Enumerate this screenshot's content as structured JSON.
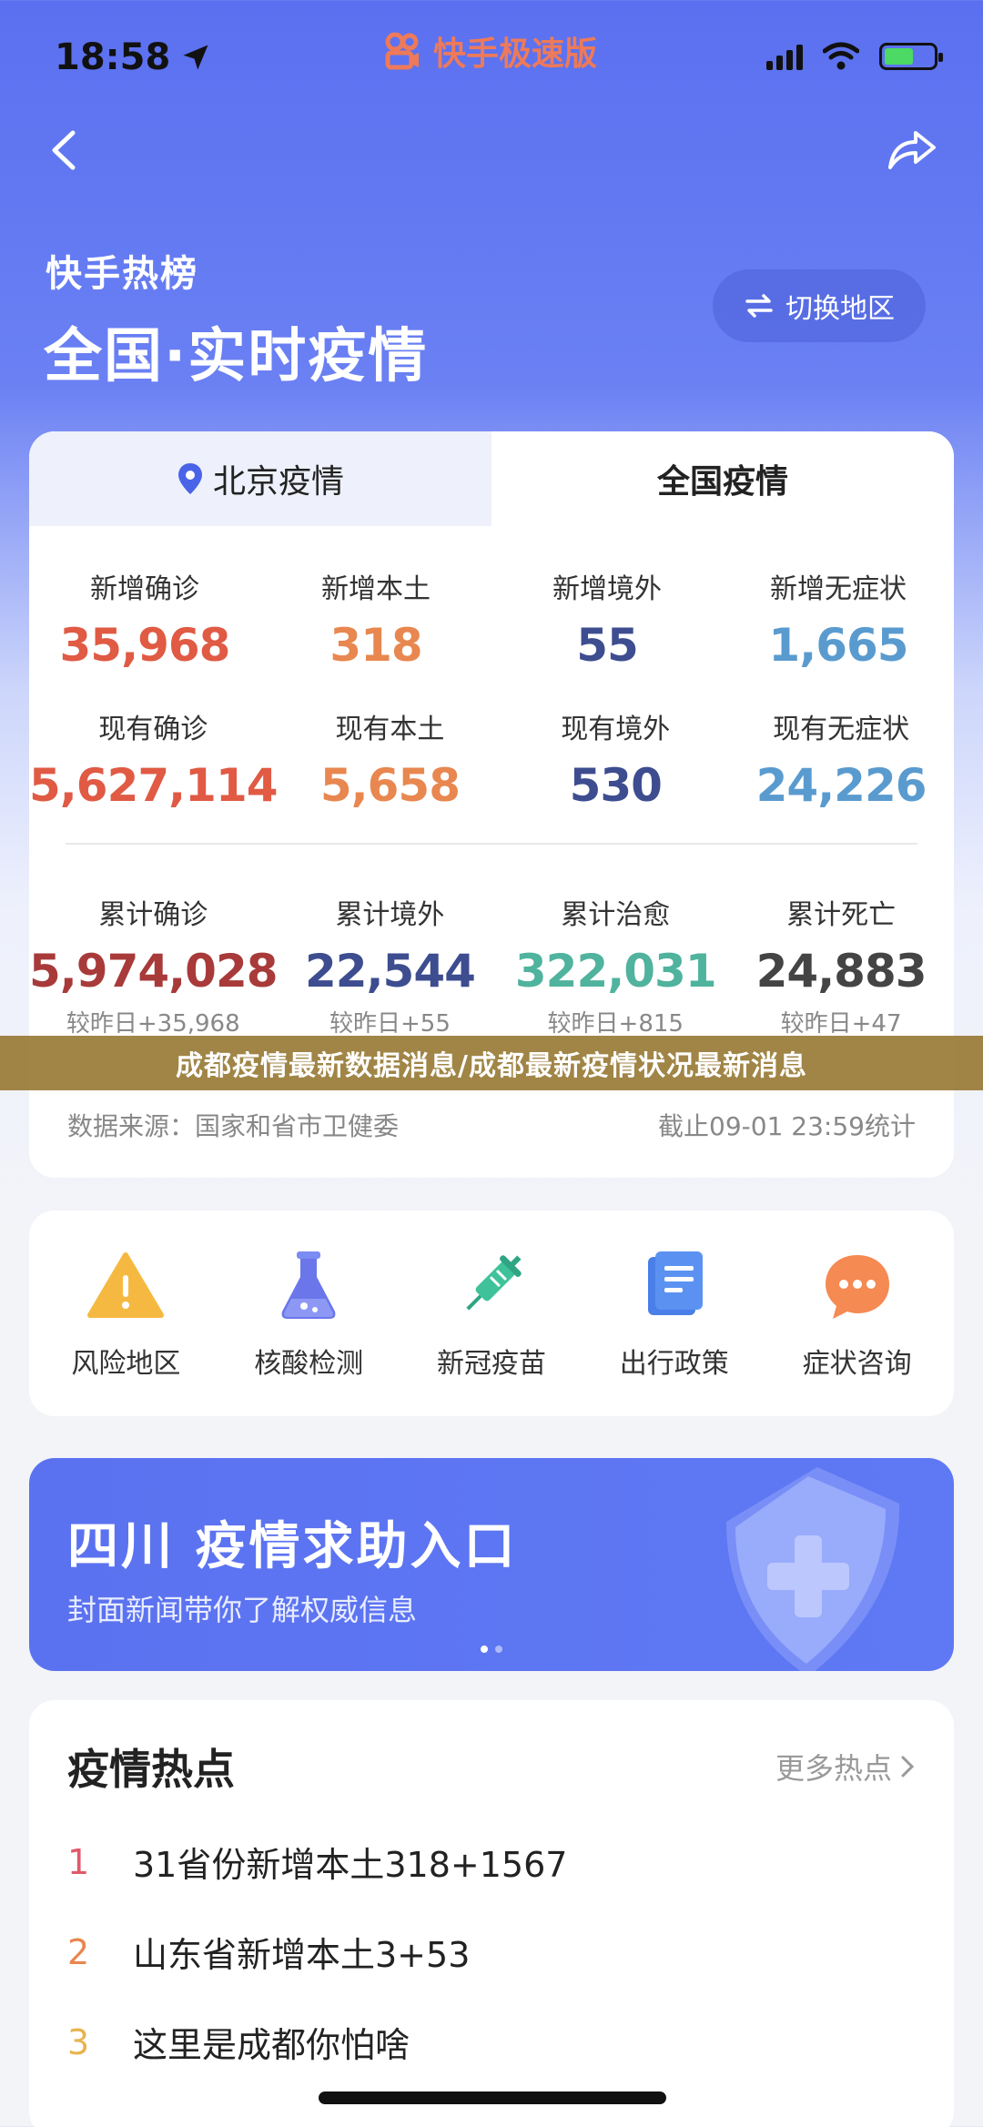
{
  "status": {
    "time": "18:58",
    "app_name": "快手极速版"
  },
  "header": {
    "section": "快手热榜",
    "title": "全国·实时疫情",
    "switch_label": "切换地区"
  },
  "tabs": {
    "local": "北京疫情",
    "national": "全国疫情"
  },
  "stats_row1": [
    {
      "label": "新增确诊",
      "value": "35,968",
      "color": "#e05a44"
    },
    {
      "label": "新增本土",
      "value": "318",
      "color": "#e8874f"
    },
    {
      "label": "新增境外",
      "value": "55",
      "color": "#3d4d8f"
    },
    {
      "label": "新增无症状",
      "value": "1,665",
      "color": "#5a9bcf"
    }
  ],
  "stats_row2": [
    {
      "label": "现有确诊",
      "value": "5,627,114",
      "color": "#e05a44"
    },
    {
      "label": "现有本土",
      "value": "5,658",
      "color": "#e8874f"
    },
    {
      "label": "现有境外",
      "value": "530",
      "color": "#3d4d8f"
    },
    {
      "label": "现有无症状",
      "value": "24,226",
      "color": "#5a9bcf"
    }
  ],
  "stats_row3": [
    {
      "label": "累计确诊",
      "value": "5,974,028",
      "delta": "较昨日+35,968",
      "color": "#a83a3a"
    },
    {
      "label": "累计境外",
      "value": "22,544",
      "delta": "较昨日+55",
      "color": "#3d4d8f"
    },
    {
      "label": "累计治愈",
      "value": "322,031",
      "delta": "较昨日+815",
      "color": "#4fb39d"
    },
    {
      "label": "累计死亡",
      "value": "24,883",
      "delta": "较昨日+47",
      "color": "#444444"
    }
  ],
  "source": {
    "left": "数据来源：国家和省市卫健委",
    "right": "截止09-01 23:59统计"
  },
  "overlay_caption": "成都疫情最新数据消息/成都最新疫情状况最新消息",
  "tools": [
    {
      "label": "风险地区",
      "icon": "warning-icon"
    },
    {
      "label": "核酸检测",
      "icon": "flask-icon"
    },
    {
      "label": "新冠疫苗",
      "icon": "syringe-icon"
    },
    {
      "label": "出行政策",
      "icon": "document-icon"
    },
    {
      "label": "症状咨询",
      "icon": "chat-icon"
    }
  ],
  "promo": {
    "title": "四川 疫情求助入口",
    "subtitle": "封面新闻带你了解权威信息"
  },
  "hot": {
    "title": "疫情热点",
    "more": "更多热点",
    "items": [
      {
        "rank": "1",
        "text": "31省份新增本土318+1567",
        "color": "#e05a6a"
      },
      {
        "rank": "2",
        "text": "山东省新增本土3+53",
        "color": "#e8874f"
      },
      {
        "rank": "3",
        "text": "这里是成都你怕啥",
        "color": "#e8b44f"
      }
    ]
  }
}
